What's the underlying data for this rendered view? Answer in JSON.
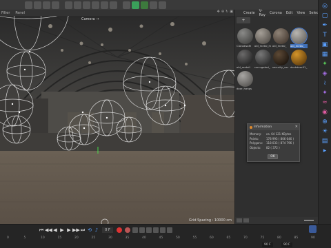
{
  "toolbar": {
    "buttons": [
      "cube-icon",
      "move-icon",
      "scale-icon",
      "rotate-icon",
      "undo-icon",
      "redo-icon",
      "render-icon",
      "render-view-icon",
      "render-settings-icon",
      "film-icon",
      "light-icon",
      "camera-icon",
      "grid-icon",
      "sphere-icon",
      "play-icon"
    ]
  },
  "viewport": {
    "menu": [
      "Filter",
      "Panel"
    ],
    "camera_label": "Camera →",
    "grid_spacing": "Grid Spacing : 10000 cm"
  },
  "material_panel": {
    "menu": [
      "Create",
      "V-Ray",
      "Corona",
      "Edit",
      "View",
      "Select"
    ],
    "materials": [
      {
        "label": "Clorodisafe",
        "color_a": "#8a8a88",
        "color_b": "#4a4a48",
        "selected": false
      },
      {
        "label": "old_metal_m",
        "color_a": "#a59f97",
        "color_b": "#5c5751",
        "selected": false
      },
      {
        "label": "old_metal_",
        "color_a": "#8f8377",
        "color_b": "#4d4138",
        "selected": false
      },
      {
        "label": "old_metal_",
        "color_a": "#b9b6b1",
        "color_b": "#6e6b67",
        "selected": true
      },
      {
        "label": "old_metall",
        "color_a": "#6b6a6a",
        "color_b": "#2a2a2a",
        "selected": false
      },
      {
        "label": "corrugated_",
        "color_a": "#787878",
        "color_b": "#333333",
        "selected": false
      },
      {
        "label": "security_var",
        "color_a": "#5e4a36",
        "color_b": "#221a12",
        "selected": false
      },
      {
        "label": "dockdoor01_",
        "color_a": "#d4952a",
        "color_b": "#6b4510",
        "selected": false
      },
      {
        "label": "door_hangs",
        "color_a": "#a8a6a3",
        "color_b": "#5e5c59",
        "selected": false
      }
    ]
  },
  "info_dialog": {
    "title": "Information",
    "rows": [
      {
        "key": "Memory:",
        "value": "ca. 64 121 KBytes"
      },
      {
        "key": "Points:",
        "value": "178 993 ( 806 646 )"
      },
      {
        "key": "Polygons:",
        "value": "118 033 ( 874 796 )"
      },
      {
        "key": "Objects:",
        "value": "82 ( 372 )"
      }
    ],
    "ok_label": "OK"
  },
  "timeline": {
    "current_frame": "0 F",
    "ruler_ticks": [
      "0",
      "5",
      "10",
      "15",
      "20",
      "25",
      "30",
      "35",
      "40",
      "45",
      "50",
      "55",
      "60",
      "65",
      "70",
      "75",
      "80",
      "85",
      "90"
    ],
    "end_frame_a": "90 F",
    "end_frame_b": "90 F"
  },
  "side_tools": [
    {
      "name": "live-select-icon",
      "glyph": "◎",
      "color": "#5aa0ff"
    },
    {
      "name": "cube-icon",
      "glyph": "▢",
      "color": "#5aa0ff"
    },
    {
      "name": "pen-icon",
      "glyph": "✒",
      "color": "#5aa0ff"
    },
    {
      "name": "text-icon",
      "glyph": "T",
      "color": "#5aa0ff"
    },
    {
      "name": "subdivide-icon",
      "glyph": "▣",
      "color": "#5aa0ff"
    },
    {
      "name": "array-icon",
      "glyph": "▦",
      "color": "#5aa0ff"
    },
    {
      "name": "cloner-icon",
      "glyph": "✦",
      "color": "#57c457"
    },
    {
      "name": "deformer-icon",
      "glyph": "◈",
      "color": "#a56ee6"
    },
    {
      "name": "spline-icon",
      "glyph": "≀",
      "color": "#5aa0ff"
    },
    {
      "name": "tag-icon",
      "glyph": "✦",
      "color": "#a56ee6"
    },
    {
      "name": "hair-icon",
      "glyph": "≈",
      "color": "#e05aa0"
    },
    {
      "name": "field-icon",
      "glyph": "◉",
      "color": "#e05aa0"
    },
    {
      "name": "globe-icon",
      "glyph": "⊕",
      "color": "#5aa0ff"
    },
    {
      "name": "light-icon",
      "glyph": "☀",
      "color": "#5aa0ff"
    },
    {
      "name": "camera-icon",
      "glyph": "▤",
      "color": "#5aa0ff"
    },
    {
      "name": "render-icon",
      "glyph": "▸",
      "color": "#5aa0ff"
    }
  ]
}
